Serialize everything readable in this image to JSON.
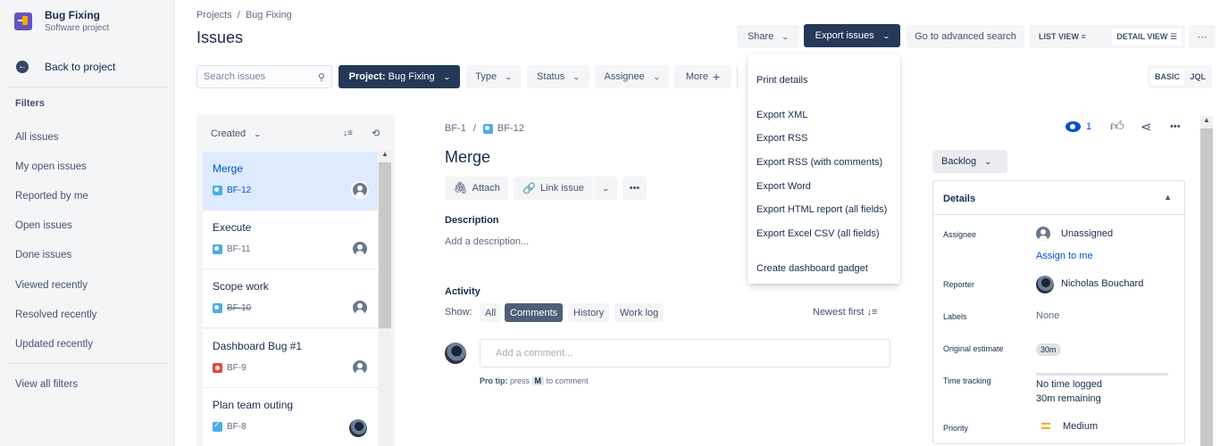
{
  "sidebar": {
    "project_name": "Bug Fixing",
    "project_type": "Software project",
    "back_label": "Back to project",
    "filters_heading": "Filters",
    "filters": [
      "All issues",
      "My open issues",
      "Reported by me",
      "Open issues",
      "Done issues",
      "Viewed recently",
      "Resolved recently",
      "Updated recently"
    ],
    "view_all": "View all filters"
  },
  "header": {
    "breadcrumb": [
      "Projects",
      "/",
      "Bug Fixing"
    ],
    "title": "Issues",
    "share_label": "Share",
    "export_label": "Export issues",
    "advanced_search_label": "Go to advanced search",
    "list_view_label": "LIST VIEW",
    "detail_view_label": "DETAIL VIEW",
    "more_icon": "⋯"
  },
  "filterbar": {
    "search_placeholder": "Search issues",
    "project_prefix": "Project:",
    "project_value": "Bug Fixing",
    "type_label": "Type",
    "status_label": "Status",
    "assignee_label": "Assignee",
    "more_label": "More",
    "basic_label": "BASIC",
    "jql_label": "JQL"
  },
  "export_menu": {
    "items": [
      "Print details",
      "Export XML",
      "Export RSS",
      "Export RSS (with comments)",
      "Export Word",
      "Export HTML report (all fields)",
      "Export Excel CSV (all fields)",
      "Create dashboard gadget"
    ]
  },
  "issue_list": {
    "sort_label": "Created",
    "items": [
      {
        "title": "Merge",
        "key": "BF-12",
        "type": "subtask",
        "assignee": "unassigned",
        "selected": true,
        "done": false
      },
      {
        "title": "Execute",
        "key": "BF-11",
        "type": "subtask",
        "assignee": "unassigned",
        "selected": false,
        "done": false
      },
      {
        "title": "Scope work",
        "key": "BF-10",
        "type": "subtask",
        "assignee": "unassigned",
        "selected": false,
        "done": true
      },
      {
        "title": "Dashboard Bug #1",
        "key": "BF-9",
        "type": "bug",
        "assignee": "unassigned",
        "selected": false,
        "done": false
      },
      {
        "title": "Plan team outing",
        "key": "BF-8",
        "type": "task",
        "assignee": "photo",
        "selected": false,
        "done": false
      }
    ]
  },
  "issue": {
    "parent_key": "BF-1",
    "key": "BF-12",
    "title": "Merge",
    "attach_label": "Attach",
    "link_label": "Link issue",
    "description_heading": "Description",
    "description_placeholder": "Add a description...",
    "activity_heading": "Activity",
    "show_label": "Show:",
    "activity_filters": [
      "All",
      "Comments",
      "History",
      "Work log"
    ],
    "activity_active": "Comments",
    "sort_order": "Newest first",
    "comment_placeholder": "Add a comment...",
    "protip_bold": "Pro tip:",
    "protip_pre": "press",
    "protip_key": "M",
    "protip_post": "to comment",
    "watchers": "1",
    "status": "Backlog"
  },
  "details": {
    "heading": "Details",
    "assignee_label": "Assignee",
    "assignee_value": "Unassigned",
    "assign_to_me": "Assign to me",
    "reporter_label": "Reporter",
    "reporter_value": "Nicholas Bouchard",
    "labels_label": "Labels",
    "labels_value": "None",
    "estimate_label": "Original estimate",
    "estimate_value": "30m",
    "tracking_label": "Time tracking",
    "tracking_logged": "No time logged",
    "tracking_remaining": "30m remaining",
    "tracking_progress": 0,
    "priority_label": "Priority",
    "priority_value": "Medium",
    "priority_color": "#ffab00"
  },
  "colors": {
    "primary_dark": "#253858",
    "link": "#0052cc",
    "selected_row": "#deebff"
  }
}
